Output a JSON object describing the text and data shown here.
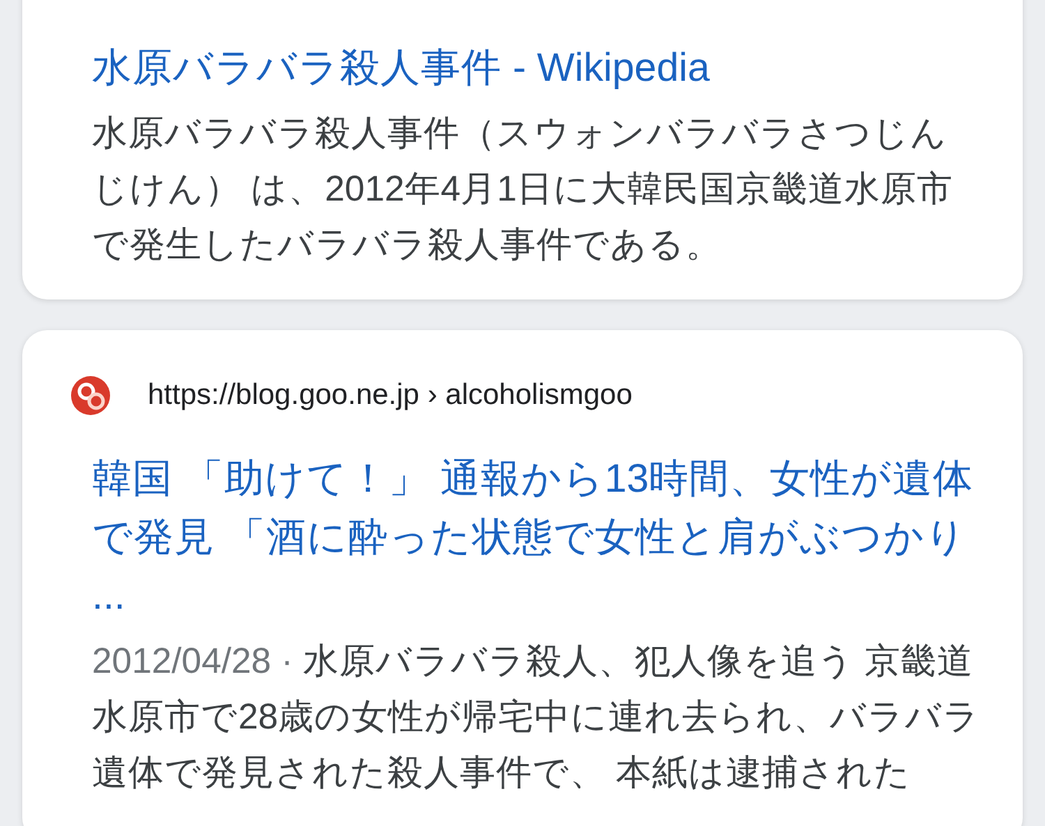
{
  "results": [
    {
      "kind": "partial",
      "title": "水原バラバラ殺人事件 - Wikipedia",
      "snippet": "水原バラバラ殺人事件（スウォンバラバラさつじんじけん） は、2012年4月1日に大韓民国京畿道水原市で発生したバラバラ殺人事件である。"
    },
    {
      "kind": "full",
      "url": "https://blog.goo.ne.jp › alcoholismgoo",
      "title": "韓国 「助けて！」 通報から13時間、女性が遺体で発見 「酒に酔った状態で女性と肩がぶつかり ...",
      "date": "2012/04/28 ·",
      "snippet": "水原バラバラ殺人、犯人像を追う 京畿道水原市で28歳の女性が帰宅中に連れ去られ、バラバラ遺体で発見された殺人事件で、 本紙は逮捕された"
    }
  ]
}
